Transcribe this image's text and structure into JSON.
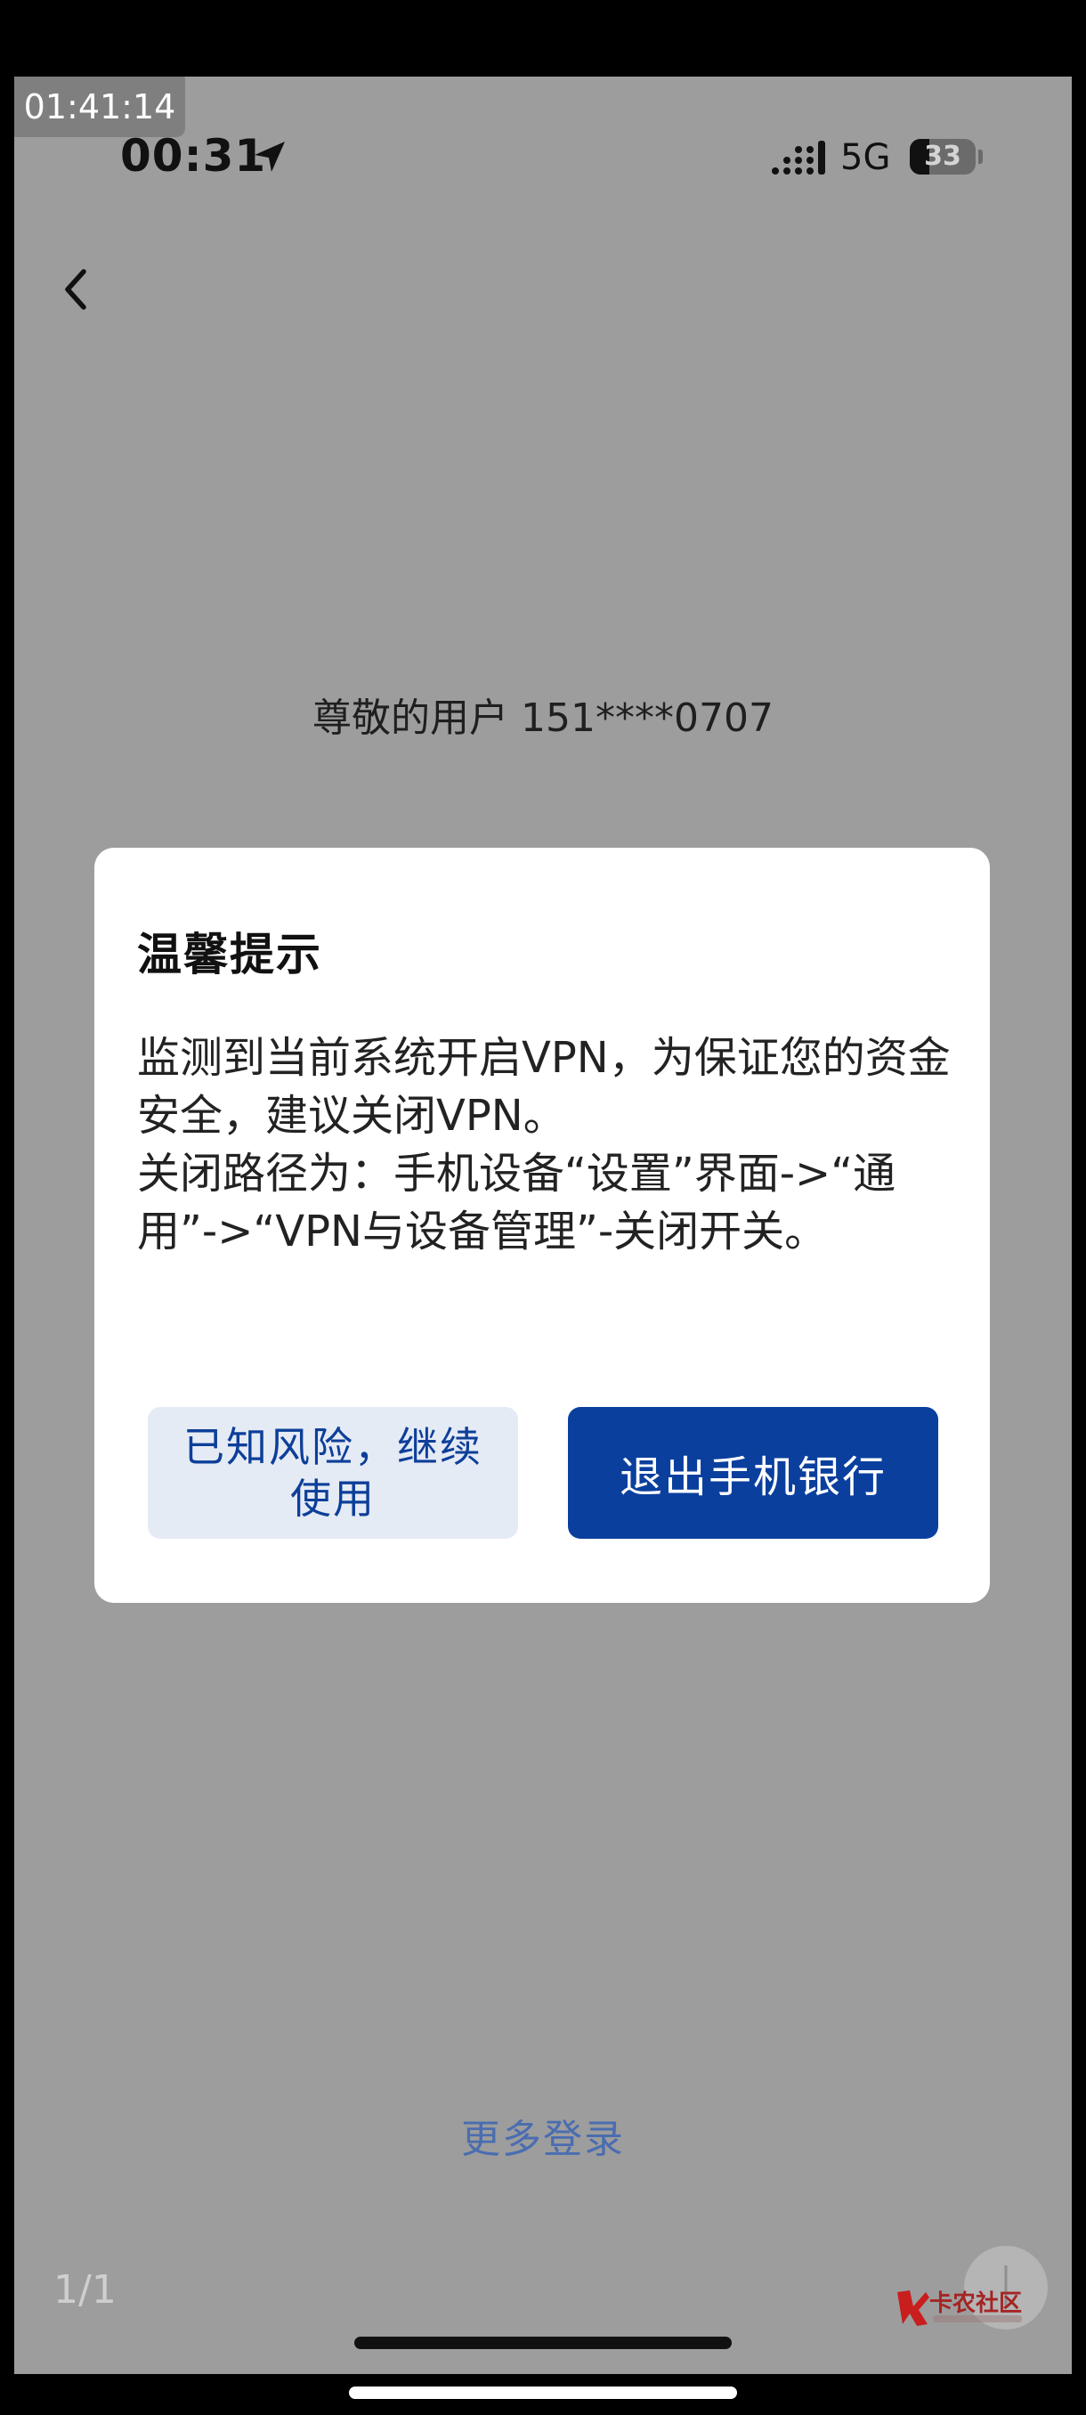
{
  "recorder": {
    "timer": "01:41:14"
  },
  "status_bar": {
    "time": "00:31",
    "network": "5G",
    "battery_level": "33",
    "location_icon": "location-arrow-icon",
    "signal_icon": "signal-dots-icon"
  },
  "nav": {
    "back_icon": "chevron-left-icon"
  },
  "greeting": "尊敬的用户 151****0707",
  "dialog": {
    "title": "温馨提示",
    "message": "监测到当前系统开启VPN，为保证您的资金安全，建议关闭VPN。\n关闭路径为：手机设备“设置”界面->“通用”->“VPN与设备管理”-关闭开关。",
    "continue_label": "已知风险，继续使用",
    "exit_label": "退出手机银行"
  },
  "more_login": "更多登录",
  "page_indicator": "1/1",
  "watermark": {
    "text": "卡农社区"
  },
  "colors": {
    "primary": "#0a3f9e",
    "secondary_bg": "#e5ebf5",
    "link": "#4a6db0",
    "overlay": "#9d9d9d"
  }
}
